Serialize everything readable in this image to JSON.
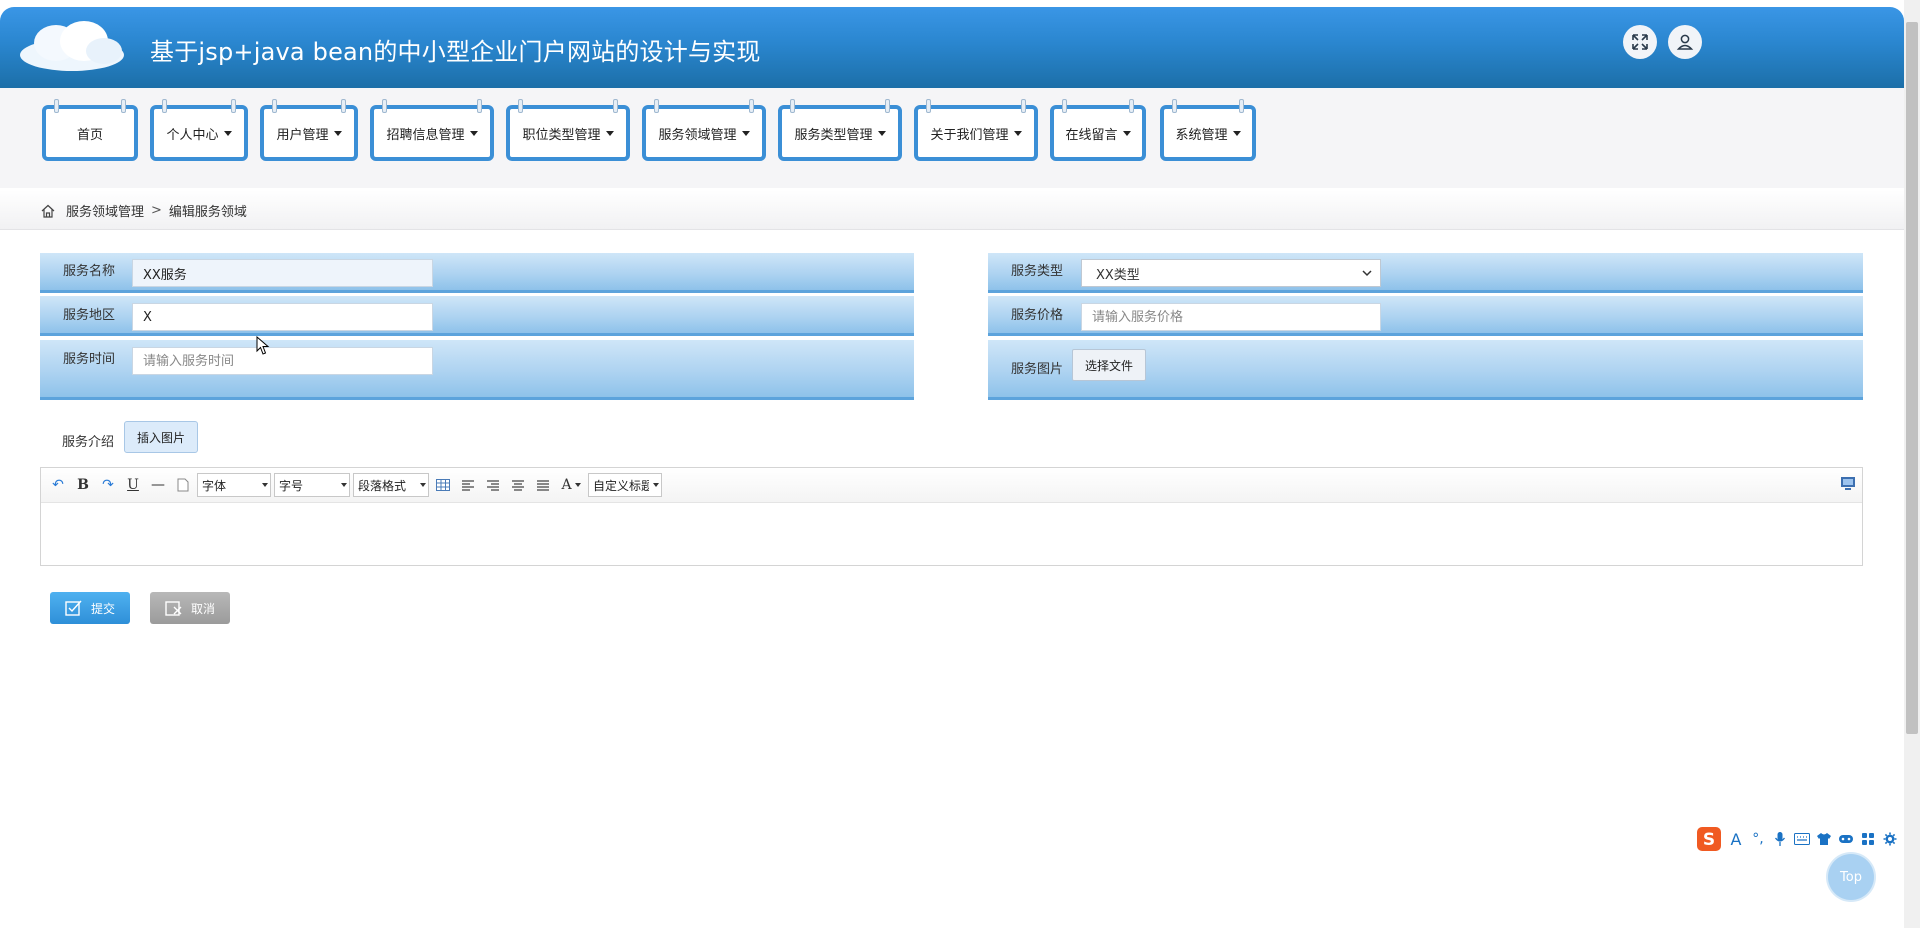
{
  "header": {
    "title": "基于jsp+java bean的中小型企业门户网站的设计与实现",
    "fullscreen_icon": "expand-icon",
    "user_icon": "user-icon"
  },
  "nav": {
    "items": [
      {
        "label": "首页",
        "dropdown": false
      },
      {
        "label": "个人中心",
        "dropdown": true
      },
      {
        "label": "用户管理",
        "dropdown": true
      },
      {
        "label": "招聘信息管理",
        "dropdown": true
      },
      {
        "label": "职位类型管理",
        "dropdown": true
      },
      {
        "label": "服务领域管理",
        "dropdown": true
      },
      {
        "label": "服务类型管理",
        "dropdown": true
      },
      {
        "label": "关于我们管理",
        "dropdown": true
      },
      {
        "label": "在线留言",
        "dropdown": true
      },
      {
        "label": "系统管理",
        "dropdown": true
      }
    ]
  },
  "breadcrumb": {
    "parent": "服务领域管理",
    "separator": ">",
    "current": "编辑服务领域"
  },
  "form": {
    "name_label": "服务名称",
    "name_value": "XX服务",
    "region_label": "服务地区",
    "region_value": "X",
    "time_label": "服务时间",
    "time_placeholder": "请输入服务时间",
    "type_label": "服务类型",
    "type_value": "XX类型",
    "price_label": "服务价格",
    "price_placeholder": "请输入服务价格",
    "image_label": "服务图片",
    "file_button": "选择文件",
    "intro_label": "服务介绍",
    "insert_image_button": "插入图片"
  },
  "editor": {
    "font_family": "字体",
    "font_size": "字号",
    "paragraph": "段落格式",
    "custom_title": "自定义标题"
  },
  "actions": {
    "submit": "提交",
    "cancel": "取消"
  },
  "top_button": "Top",
  "colors": {
    "header_blue": "#2a86cf",
    "nav_border": "#3b8fd6",
    "row_blue": "#aed3f1",
    "submit": "#2e8fd8",
    "cancel": "#9b9b9b"
  }
}
